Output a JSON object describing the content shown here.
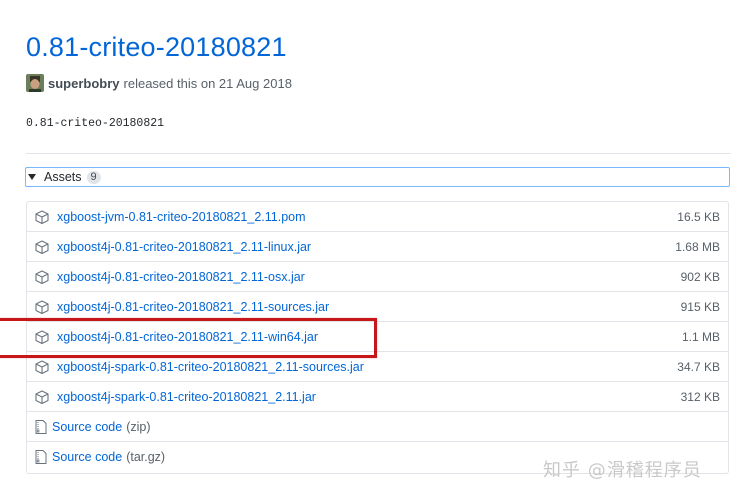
{
  "release": {
    "title": "0.81-criteo-20180821",
    "author": "superbobry",
    "released_text": "released this on 21 Aug 2018",
    "body": "0.81-criteo-20180821"
  },
  "assets": {
    "label": "Assets",
    "count": "9",
    "files": [
      {
        "name": "xgboost-jvm-0.81-criteo-20180821_2.11.pom",
        "size": "16.5 KB"
      },
      {
        "name": "xgboost4j-0.81-criteo-20180821_2.11-linux.jar",
        "size": "1.68 MB"
      },
      {
        "name": "xgboost4j-0.81-criteo-20180821_2.11-osx.jar",
        "size": "902 KB"
      },
      {
        "name": "xgboost4j-0.81-criteo-20180821_2.11-sources.jar",
        "size": "915 KB"
      },
      {
        "name": "xgboost4j-0.81-criteo-20180821_2.11-win64.jar",
        "size": "1.1 MB"
      },
      {
        "name": "xgboost4j-spark-0.81-criteo-20180821_2.11-sources.jar",
        "size": "34.7 KB"
      },
      {
        "name": "xgboost4j-spark-0.81-criteo-20180821_2.11.jar",
        "size": "312 KB"
      }
    ],
    "source": [
      {
        "label": "Source code",
        "ext": "(zip)"
      },
      {
        "label": "Source code",
        "ext": "(tar.gz)"
      }
    ]
  },
  "watermark": "知乎 @滑稽程序员",
  "colors": {
    "link": "#0366d6",
    "highlight": "#c8171b",
    "border": "#e1e4e8"
  }
}
